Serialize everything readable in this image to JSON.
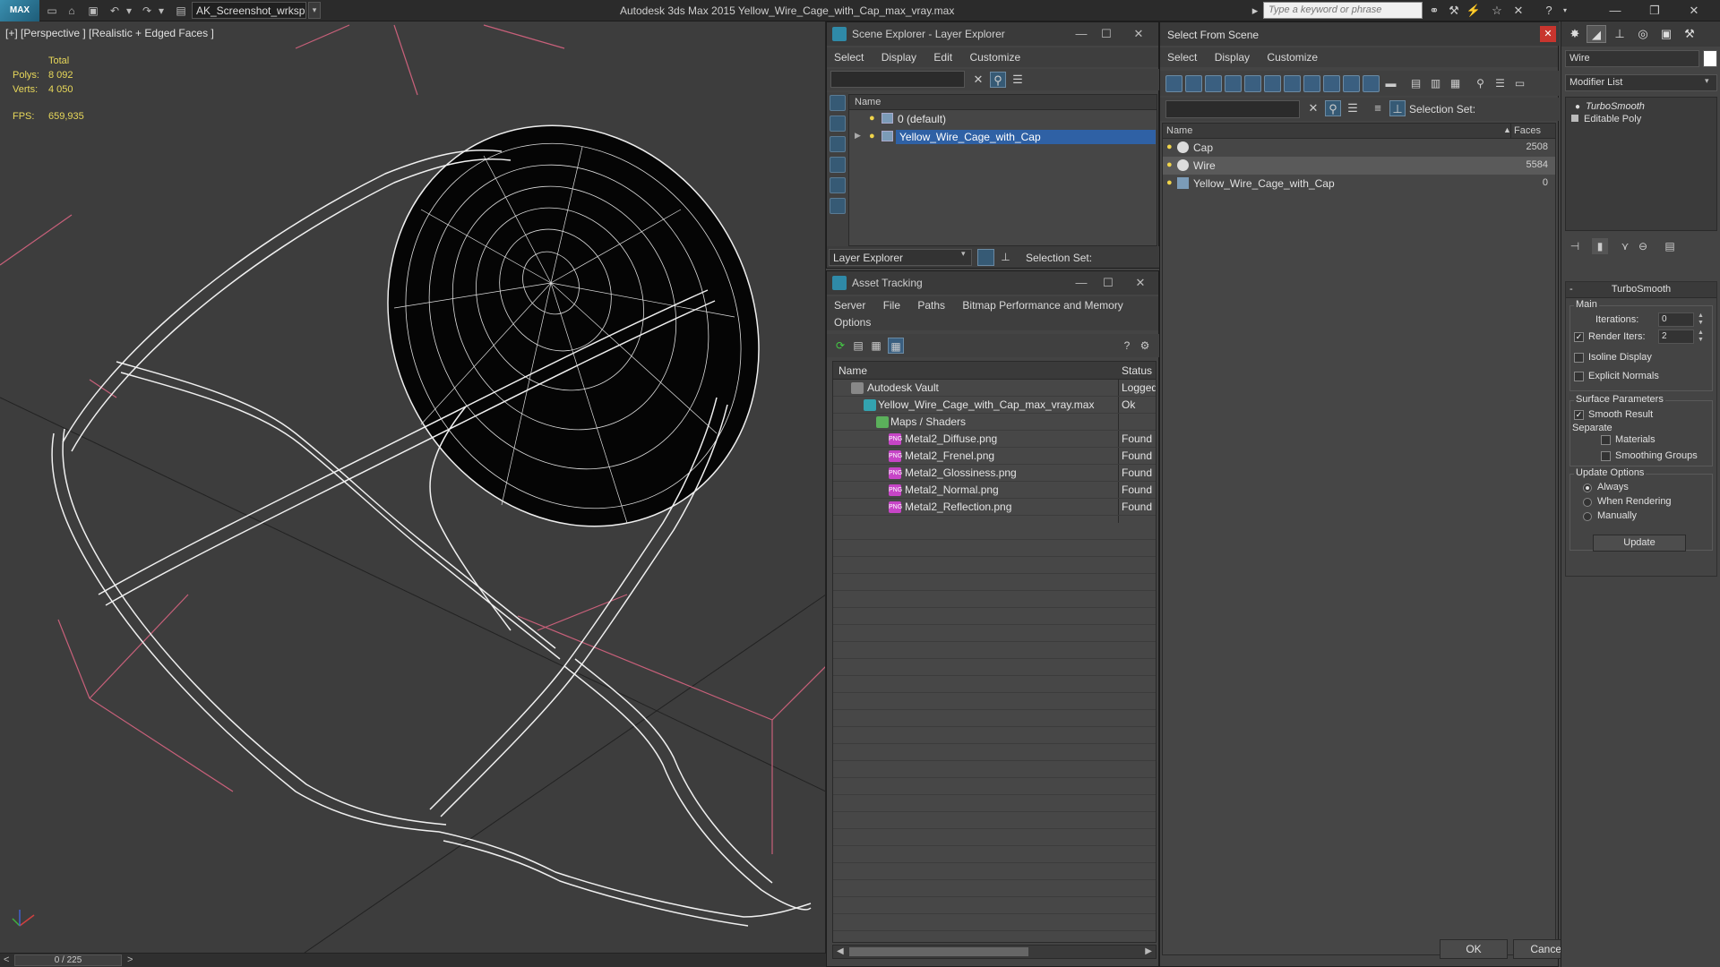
{
  "titlebar": {
    "logo": "MAX",
    "workspace": "AK_Screenshot_wrksp",
    "title": "Autodesk 3ds Max  2015     Yellow_Wire_Cage_with_Cap_max_vray.max",
    "search_placeholder": "Type a keyword or phrase"
  },
  "viewport": {
    "label": "[+] [Perspective ] [Realistic + Edged Faces ]",
    "stats": {
      "total_label": "Total",
      "polys_label": "Polys:",
      "polys_value": "8 092",
      "verts_label": "Verts:",
      "verts_value": "4 050",
      "fps_label": "FPS:",
      "fps_value": "659,935"
    }
  },
  "timeslider": {
    "prev": "<",
    "next": ">",
    "frame": "0 / 225"
  },
  "scene_explorer": {
    "title": "Scene Explorer - Layer Explorer",
    "menu": [
      "Select",
      "Display",
      "Edit",
      "Customize"
    ],
    "column_name": "Name",
    "rows": [
      {
        "label": "0 (default)"
      },
      {
        "label": "Yellow_Wire_Cage_with_Cap"
      }
    ],
    "footer_dropdown": "Layer Explorer",
    "selection_set_label": "Selection Set:"
  },
  "asset_tracking": {
    "title": "Asset Tracking",
    "menu_row1": [
      "Server",
      "File",
      "Paths",
      "Bitmap Performance and Memory"
    ],
    "menu_row2": [
      "Options"
    ],
    "columns": {
      "name": "Name",
      "status": "Status"
    },
    "rows": [
      {
        "name": "Autodesk Vault",
        "status": "Logged"
      },
      {
        "name": "Yellow_Wire_Cage_with_Cap_max_vray.max",
        "status": "Ok"
      },
      {
        "name": "Maps / Shaders",
        "status": ""
      },
      {
        "name": "Metal2_Diffuse.png",
        "status": "Found"
      },
      {
        "name": "Metal2_Frenel.png",
        "status": "Found"
      },
      {
        "name": "Metal2_Glossiness.png",
        "status": "Found"
      },
      {
        "name": "Metal2_Normal.png",
        "status": "Found"
      },
      {
        "name": "Metal2_Reflection.png",
        "status": "Found"
      }
    ],
    "png_badge": "PNG"
  },
  "select_from_scene": {
    "title": "Select From Scene",
    "menu": [
      "Select",
      "Display",
      "Customize"
    ],
    "selection_set_label": "Selection Set:",
    "columns": {
      "name": "Name",
      "faces": "Faces"
    },
    "rows": [
      {
        "name": "Cap",
        "faces": "2508"
      },
      {
        "name": "Wire",
        "faces": "5584"
      },
      {
        "name": "Yellow_Wire_Cage_with_Cap",
        "faces": "0"
      }
    ],
    "ok_label": "OK",
    "cancel_label": "Cancel"
  },
  "command_panel": {
    "object_name": "Wire",
    "modifier_list": "Modifier List",
    "stack": [
      "TurboSmooth",
      "Editable Poly"
    ],
    "turbosmooth": {
      "rollout_title": "TurboSmooth",
      "main_label": "Main",
      "iterations_label": "Iterations:",
      "iterations_value": "0",
      "render_iters_label": "Render Iters:",
      "render_iters_value": "2",
      "isoline_label": "Isoline Display",
      "explicit_normals_label": "Explicit Normals",
      "surface_params_label": "Surface Parameters",
      "smooth_result_label": "Smooth Result",
      "separate_label": "Separate",
      "materials_label": "Materials",
      "smoothing_groups_label": "Smoothing Groups",
      "update_options_label": "Update Options",
      "always_label": "Always",
      "when_rendering_label": "When Rendering",
      "manually_label": "Manually",
      "update_button": "Update"
    }
  }
}
